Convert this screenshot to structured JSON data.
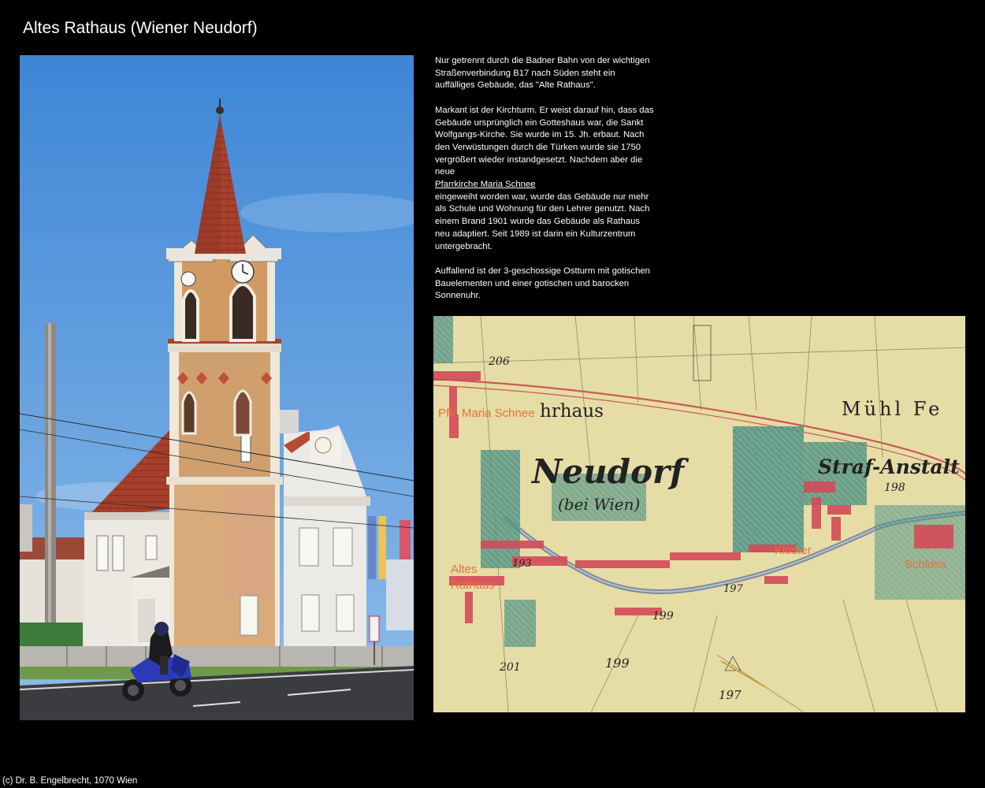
{
  "page": {
    "title": "Altes Rathaus (Wiener Neudorf)",
    "footer": "(c) Dr. B. Engelbrecht, 1070 Wien"
  },
  "description": {
    "p1": "Nur getrennt durch die Badner Bahn von der wichtigen Straßenverbindung B17 nach Süden steht ein auffälliges Gebäude, das \"Alte Rathaus\".",
    "p2_before": "Markant ist der Kirchturm. Er weist darauf hin, dass das Gebäude ursprünglich ein Gotteshaus war, die Sankt Wolfgangs-Kirche. Sie wurde im 15. Jh. erbaut. Nach den Verwüstungen durch die Türken wurde sie 1750 vergrößert wieder instandgesetzt. Nachdem aber die neue",
    "p2_link": "Pfarrkirche Maria Schnee",
    "p2_after": "eingeweiht worden war, wurde das Gebäude nur mehr als Schule und Wohnung für den Lehrer genutzt. Nach einem Brand 1901 wurde das Gebäude als Rathaus neu adaptiert. Seit 1989 ist darin ein Kulturzentrum untergebracht.",
    "p3": "Auffallend ist der 3-geschossige Ostturm mit gotischen Bauelementen und einer gotischen und barocken Sonnenuhr."
  },
  "map": {
    "labels": {
      "town": "Neudorf",
      "town_sub": "(bei Wien)",
      "muehl": "Mühl Fe",
      "anstalt": "Straf-Anstalt",
      "brauhaus": "hrhaus",
      "n206": "206",
      "n198": "198",
      "n193": "193",
      "n197": "197",
      "n199": "199",
      "n201": "201",
      "n199b": "199",
      "n197b": "197"
    },
    "annotations": {
      "maria_schnee": "Pfk. Maria Schnee",
      "altes_rathaus_1": "Altes",
      "altes_rathaus_2": "Rathaus",
      "kloster": "Kloster",
      "schloss": "Schloss"
    }
  },
  "colors": {
    "background": "#000000",
    "text": "#ffffff",
    "annotation": "#e8703a",
    "map_paper": "#e6dca6",
    "map_buildings": "#d44a5a",
    "map_gardens": "#4e8f80",
    "sky": "#4a8fd8"
  }
}
